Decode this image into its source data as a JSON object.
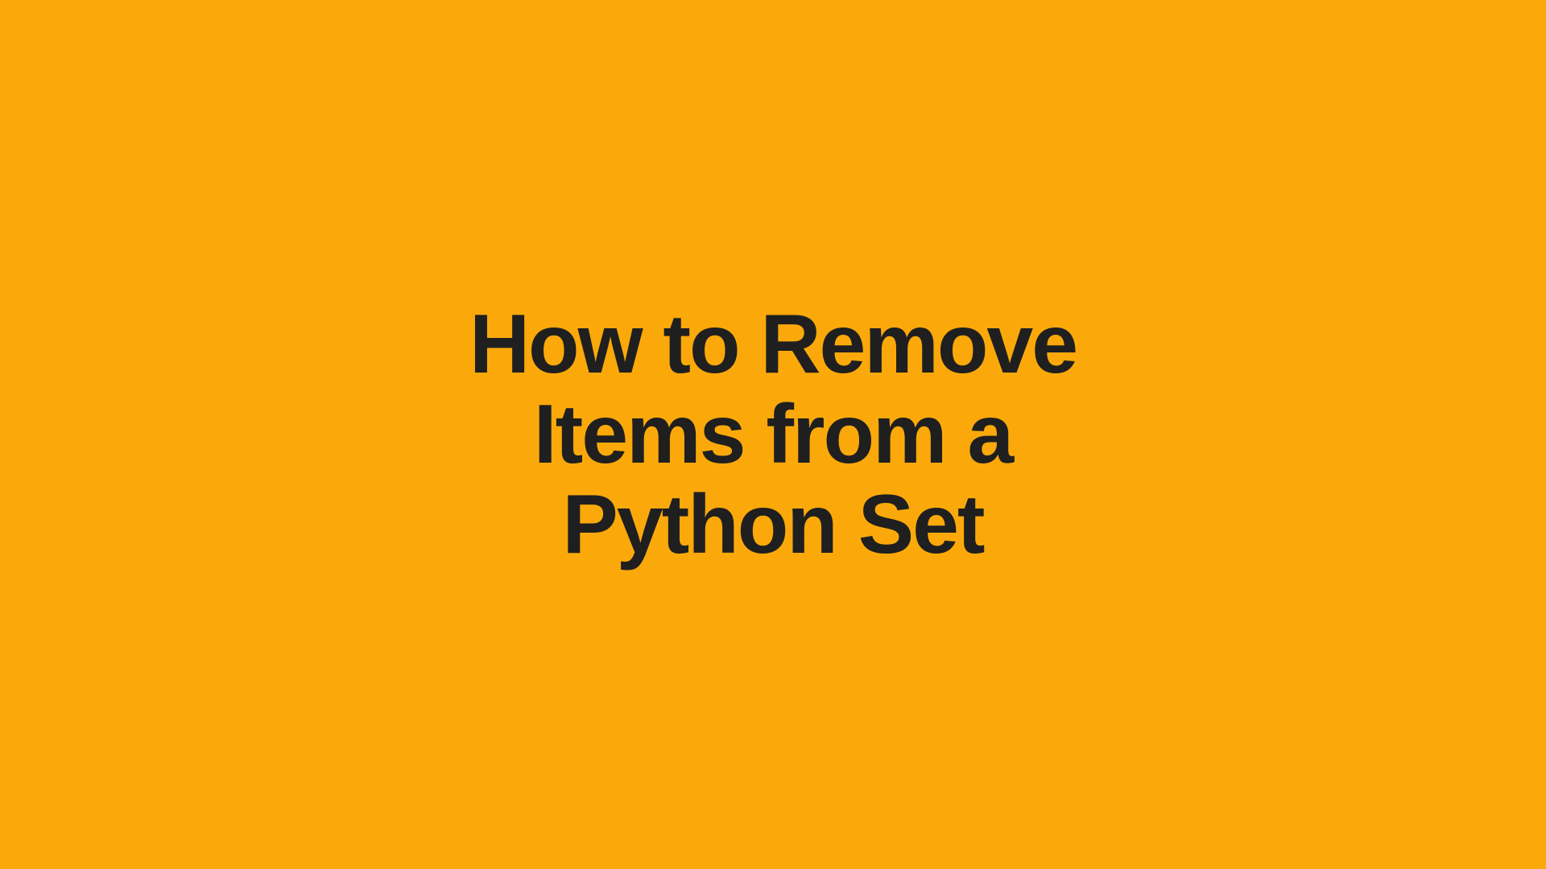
{
  "heading": {
    "line1": "How to Remove",
    "line2": "Items from a",
    "line3": "Python Set"
  },
  "colors": {
    "background": "#fba90a",
    "text": "#1f1f1f"
  }
}
